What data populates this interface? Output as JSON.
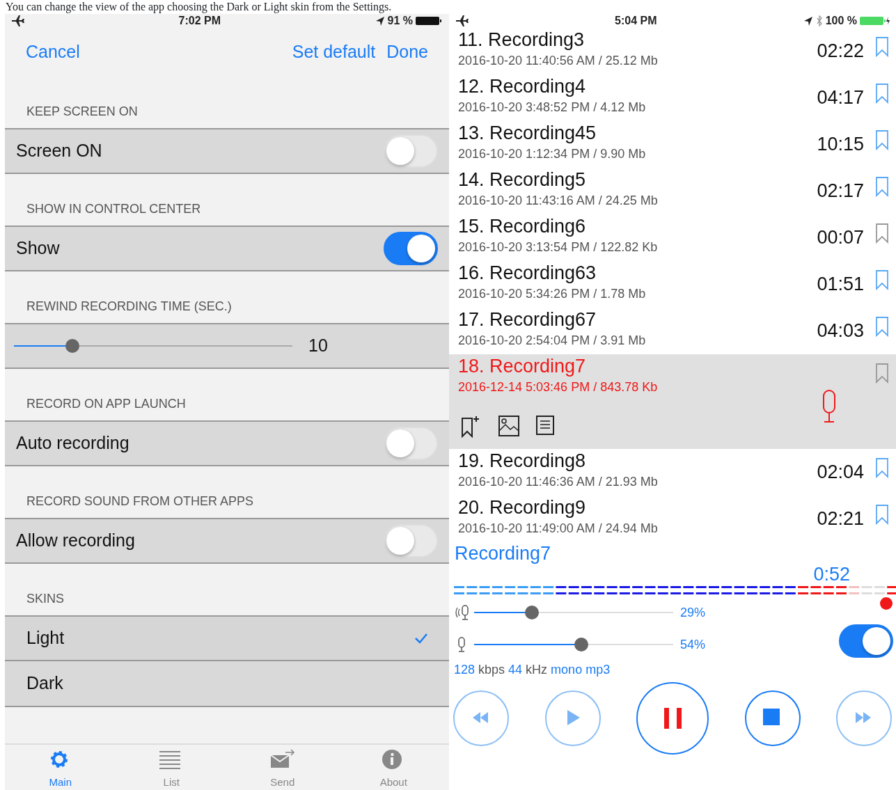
{
  "caption": "You can change the view of the app choosing the Dark or Light skin from the Settings.",
  "settings_screen": {
    "status_bar": {
      "time": "7:02 PM",
      "battery": "91 %"
    },
    "nav": {
      "cancel": "Cancel",
      "actions": [
        "Set default",
        "Done"
      ]
    },
    "sections": [
      {
        "header": "KEEP SCREEN ON",
        "rows": [
          {
            "kind": "toggle",
            "label": "Screen ON",
            "on": false
          }
        ]
      },
      {
        "header": "SHOW IN CONTROL CENTER",
        "rows": [
          {
            "kind": "toggle",
            "label": "Show",
            "on": true
          }
        ]
      },
      {
        "header": "REWIND RECORDING TIME (SEC.)",
        "rows": [
          {
            "kind": "slider",
            "level": 0.21,
            "value": "10"
          }
        ]
      },
      {
        "header": "RECORD ON APP LAUNCH",
        "rows": [
          {
            "kind": "toggle",
            "label": "Auto recording",
            "on": false
          }
        ]
      },
      {
        "header": "RECORD SOUND FROM OTHER APPS",
        "rows": [
          {
            "kind": "toggle",
            "label": "Allow recording",
            "on": false
          }
        ]
      },
      {
        "header": "SKINS",
        "rows": [
          {
            "kind": "choice",
            "label": "Light",
            "selected": true
          },
          {
            "kind": "choice",
            "label": "Dark",
            "selected": false
          }
        ]
      }
    ],
    "tab_bar": [
      {
        "kind": "gear",
        "label": "Main",
        "selected": true
      },
      {
        "kind": "list",
        "label": "List",
        "selected": false
      },
      {
        "kind": "mail",
        "label": "Send",
        "selected": false
      },
      {
        "kind": "info",
        "label": "About",
        "selected": false
      }
    ]
  },
  "recorder_screen": {
    "status_bar": {
      "time": "5:04 PM",
      "battery": "100 %"
    },
    "recordings": [
      {
        "title": "11. Recording3",
        "meta": "2016-10-20 11:40:56 AM / 25.12 Mb",
        "duration": "02:22",
        "marked": true,
        "selected": false
      },
      {
        "title": "12. Recording4",
        "meta": "2016-10-20 3:48:52 PM / 4.12 Mb",
        "duration": "04:17",
        "marked": true,
        "selected": false
      },
      {
        "title": "13. Recording45",
        "meta": "2016-10-20 1:12:34 PM / 9.90 Mb",
        "duration": "10:15",
        "marked": true,
        "selected": false
      },
      {
        "title": "14. Recording5",
        "meta": "2016-10-20 11:43:16 AM / 24.25 Mb",
        "duration": "02:17",
        "marked": true,
        "selected": false
      },
      {
        "title": "15. Recording6",
        "meta": "2016-10-20 3:13:54 PM / 122.82 Kb",
        "duration": "00:07",
        "marked": false,
        "selected": false
      },
      {
        "title": "16. Recording63",
        "meta": "2016-10-20 5:34:26 PM / 1.78 Mb",
        "duration": "01:51",
        "marked": true,
        "selected": false
      },
      {
        "title": "17. Recording67",
        "meta": "2016-10-20 2:54:04 PM / 3.91 Mb",
        "duration": "04:03",
        "marked": true,
        "selected": false
      },
      {
        "title": "18. Recording7",
        "meta": "2016-12-14 5:03:46 PM / 843.78 Kb",
        "marked": false,
        "selected": true
      },
      {
        "title": "19. Recording8",
        "meta": "2016-10-20 11:46:36 AM / 21.93 Mb",
        "duration": "02:04",
        "marked": true,
        "selected": false
      },
      {
        "title": "20. Recording9",
        "meta": "2016-10-20 11:49:00 AM / 24.94 Mb",
        "duration": "02:21",
        "marked": true,
        "selected": false
      }
    ],
    "player": {
      "title": "Recording7",
      "elapsed": "0:52",
      "sliders": [
        {
          "kind": "loud",
          "level": 0.29,
          "reading": "29%"
        },
        {
          "kind": "mic",
          "level": 0.54,
          "reading": "54%"
        }
      ],
      "switch_on": true,
      "format": [
        {
          "kind": "value",
          "text": "128"
        },
        {
          "kind": "unit",
          "text": "kbps"
        },
        {
          "kind": "value",
          "text": "44"
        },
        {
          "kind": "unit",
          "text": "kHz"
        },
        {
          "kind": "value",
          "text": "mono"
        },
        {
          "kind": "value",
          "text": "mp3"
        }
      ],
      "buttons": [
        {
          "kind": "rewind"
        },
        {
          "kind": "play"
        },
        {
          "kind": "pause"
        },
        {
          "kind": "stop"
        },
        {
          "kind": "forward"
        }
      ]
    }
  }
}
